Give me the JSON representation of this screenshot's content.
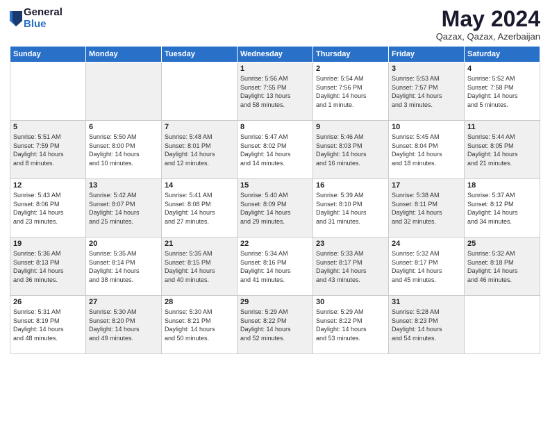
{
  "logo": {
    "general": "General",
    "blue": "Blue"
  },
  "header": {
    "month": "May 2024",
    "location": "Qazax, Qazax, Azerbaijan"
  },
  "weekdays": [
    "Sunday",
    "Monday",
    "Tuesday",
    "Wednesday",
    "Thursday",
    "Friday",
    "Saturday"
  ],
  "weeks": [
    [
      {
        "day": "",
        "info": ""
      },
      {
        "day": "",
        "info": ""
      },
      {
        "day": "",
        "info": ""
      },
      {
        "day": "1",
        "info": "Sunrise: 5:56 AM\nSunset: 7:55 PM\nDaylight: 13 hours\nand 58 minutes."
      },
      {
        "day": "2",
        "info": "Sunrise: 5:54 AM\nSunset: 7:56 PM\nDaylight: 14 hours\nand 1 minute."
      },
      {
        "day": "3",
        "info": "Sunrise: 5:53 AM\nSunset: 7:57 PM\nDaylight: 14 hours\nand 3 minutes."
      },
      {
        "day": "4",
        "info": "Sunrise: 5:52 AM\nSunset: 7:58 PM\nDaylight: 14 hours\nand 5 minutes."
      }
    ],
    [
      {
        "day": "5",
        "info": "Sunrise: 5:51 AM\nSunset: 7:59 PM\nDaylight: 14 hours\nand 8 minutes."
      },
      {
        "day": "6",
        "info": "Sunrise: 5:50 AM\nSunset: 8:00 PM\nDaylight: 14 hours\nand 10 minutes."
      },
      {
        "day": "7",
        "info": "Sunrise: 5:48 AM\nSunset: 8:01 PM\nDaylight: 14 hours\nand 12 minutes."
      },
      {
        "day": "8",
        "info": "Sunrise: 5:47 AM\nSunset: 8:02 PM\nDaylight: 14 hours\nand 14 minutes."
      },
      {
        "day": "9",
        "info": "Sunrise: 5:46 AM\nSunset: 8:03 PM\nDaylight: 14 hours\nand 16 minutes."
      },
      {
        "day": "10",
        "info": "Sunrise: 5:45 AM\nSunset: 8:04 PM\nDaylight: 14 hours\nand 18 minutes."
      },
      {
        "day": "11",
        "info": "Sunrise: 5:44 AM\nSunset: 8:05 PM\nDaylight: 14 hours\nand 21 minutes."
      }
    ],
    [
      {
        "day": "12",
        "info": "Sunrise: 5:43 AM\nSunset: 8:06 PM\nDaylight: 14 hours\nand 23 minutes."
      },
      {
        "day": "13",
        "info": "Sunrise: 5:42 AM\nSunset: 8:07 PM\nDaylight: 14 hours\nand 25 minutes."
      },
      {
        "day": "14",
        "info": "Sunrise: 5:41 AM\nSunset: 8:08 PM\nDaylight: 14 hours\nand 27 minutes."
      },
      {
        "day": "15",
        "info": "Sunrise: 5:40 AM\nSunset: 8:09 PM\nDaylight: 14 hours\nand 29 minutes."
      },
      {
        "day": "16",
        "info": "Sunrise: 5:39 AM\nSunset: 8:10 PM\nDaylight: 14 hours\nand 31 minutes."
      },
      {
        "day": "17",
        "info": "Sunrise: 5:38 AM\nSunset: 8:11 PM\nDaylight: 14 hours\nand 32 minutes."
      },
      {
        "day": "18",
        "info": "Sunrise: 5:37 AM\nSunset: 8:12 PM\nDaylight: 14 hours\nand 34 minutes."
      }
    ],
    [
      {
        "day": "19",
        "info": "Sunrise: 5:36 AM\nSunset: 8:13 PM\nDaylight: 14 hours\nand 36 minutes."
      },
      {
        "day": "20",
        "info": "Sunrise: 5:35 AM\nSunset: 8:14 PM\nDaylight: 14 hours\nand 38 minutes."
      },
      {
        "day": "21",
        "info": "Sunrise: 5:35 AM\nSunset: 8:15 PM\nDaylight: 14 hours\nand 40 minutes."
      },
      {
        "day": "22",
        "info": "Sunrise: 5:34 AM\nSunset: 8:16 PM\nDaylight: 14 hours\nand 41 minutes."
      },
      {
        "day": "23",
        "info": "Sunrise: 5:33 AM\nSunset: 8:17 PM\nDaylight: 14 hours\nand 43 minutes."
      },
      {
        "day": "24",
        "info": "Sunrise: 5:32 AM\nSunset: 8:17 PM\nDaylight: 14 hours\nand 45 minutes."
      },
      {
        "day": "25",
        "info": "Sunrise: 5:32 AM\nSunset: 8:18 PM\nDaylight: 14 hours\nand 46 minutes."
      }
    ],
    [
      {
        "day": "26",
        "info": "Sunrise: 5:31 AM\nSunset: 8:19 PM\nDaylight: 14 hours\nand 48 minutes."
      },
      {
        "day": "27",
        "info": "Sunrise: 5:30 AM\nSunset: 8:20 PM\nDaylight: 14 hours\nand 49 minutes."
      },
      {
        "day": "28",
        "info": "Sunrise: 5:30 AM\nSunset: 8:21 PM\nDaylight: 14 hours\nand 50 minutes."
      },
      {
        "day": "29",
        "info": "Sunrise: 5:29 AM\nSunset: 8:22 PM\nDaylight: 14 hours\nand 52 minutes."
      },
      {
        "day": "30",
        "info": "Sunrise: 5:29 AM\nSunset: 8:22 PM\nDaylight: 14 hours\nand 53 minutes."
      },
      {
        "day": "31",
        "info": "Sunrise: 5:28 AM\nSunset: 8:23 PM\nDaylight: 14 hours\nand 54 minutes."
      },
      {
        "day": "",
        "info": ""
      }
    ]
  ]
}
